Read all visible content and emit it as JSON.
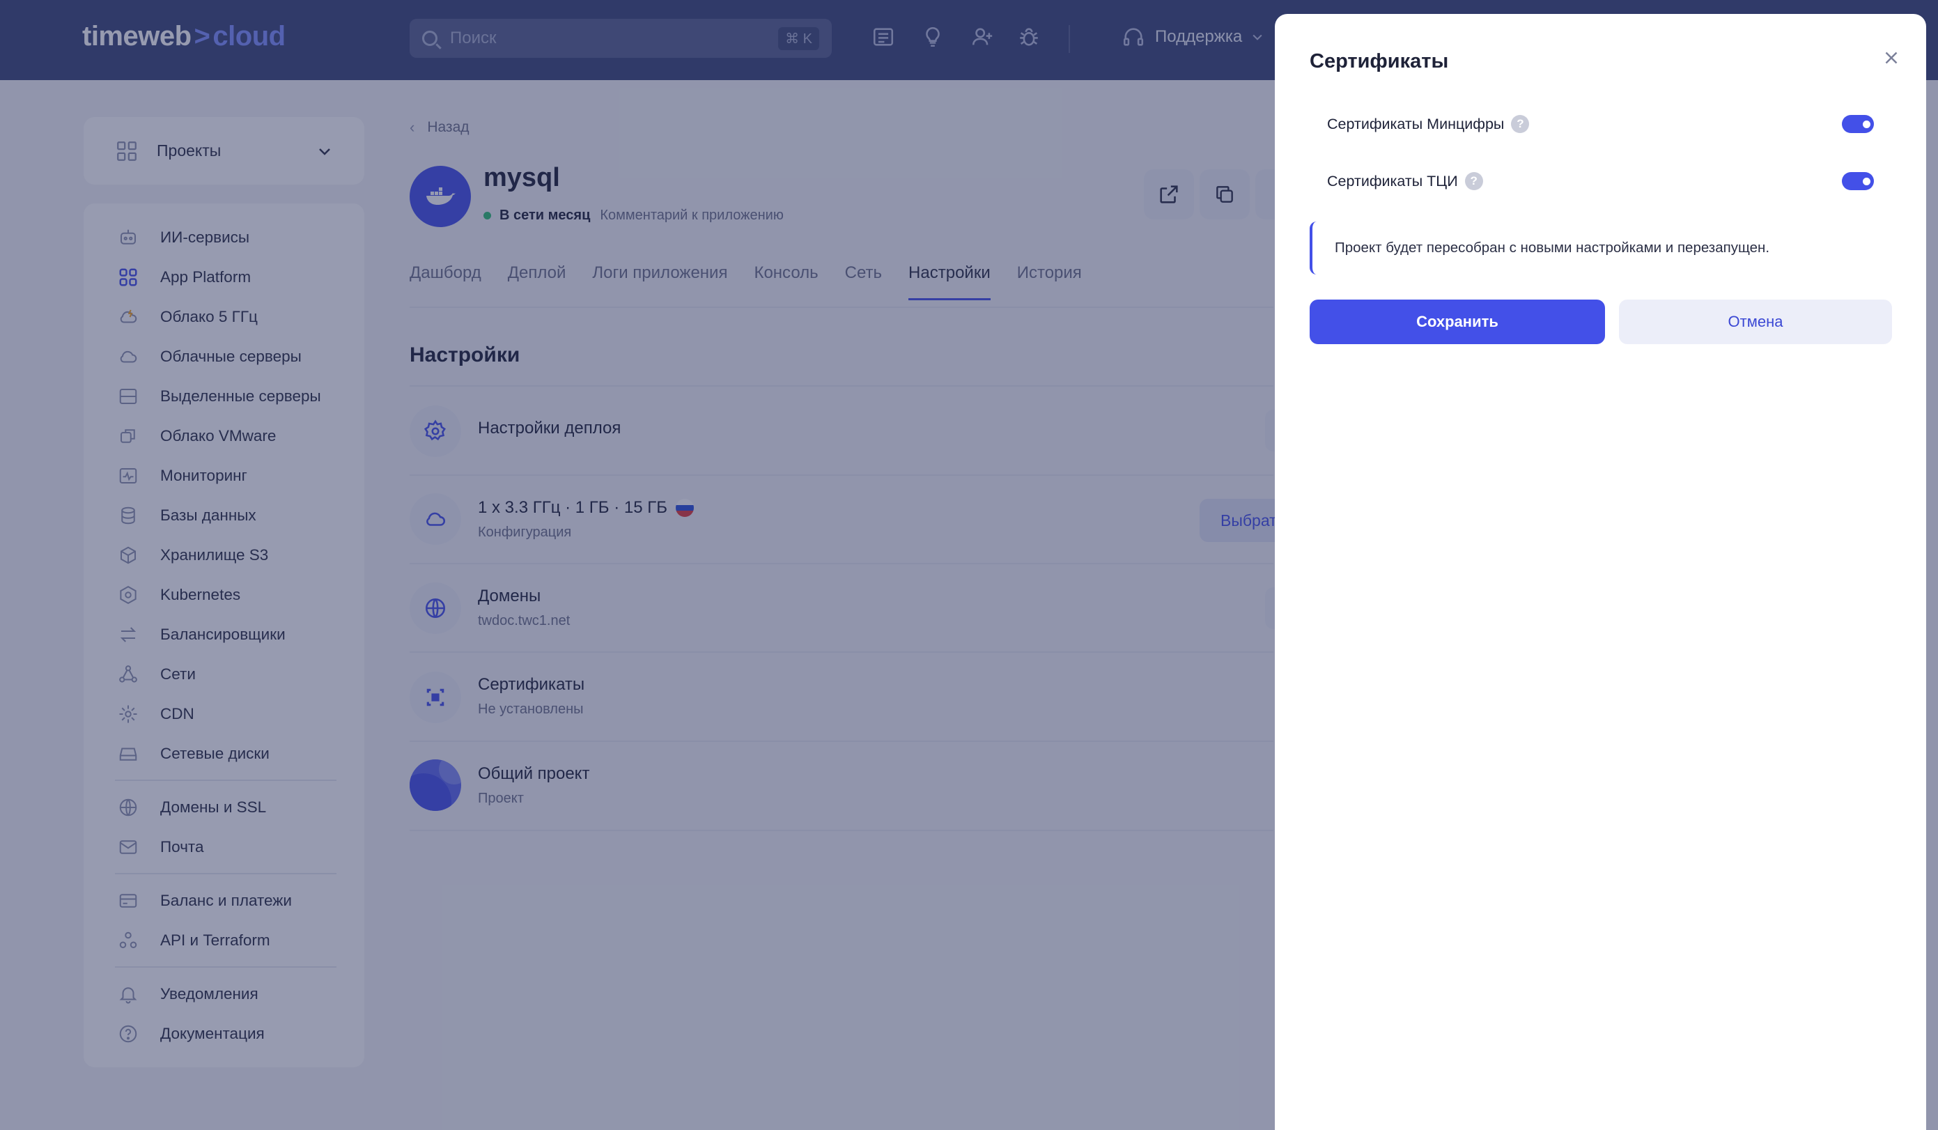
{
  "header": {
    "logo_main": "timeweb",
    "logo_arrow": ">",
    "logo_accent": "cloud",
    "search_placeholder": "Поиск",
    "search_shortcut": "⌘ K",
    "support_label": "Поддержка",
    "icons": [
      "news-icon",
      "lightbulb-icon",
      "add-user-icon",
      "bug-icon",
      "headset-icon"
    ]
  },
  "sidebar": {
    "projects_label": "Проекты",
    "items": [
      {
        "label": "ИИ-сервисы",
        "icon": "robot-icon"
      },
      {
        "label": "App Platform",
        "icon": "app-grid-icon"
      },
      {
        "label": "Облако 5 ГГц",
        "icon": "cloud-lightning-icon"
      },
      {
        "label": "Облачные серверы",
        "icon": "cloud-icon"
      },
      {
        "label": "Выделенные серверы",
        "icon": "server-icon"
      },
      {
        "label": "Облако VMware",
        "icon": "vmware-icon"
      },
      {
        "label": "Мониторинг",
        "icon": "monitoring-icon"
      },
      {
        "label": "Базы данных",
        "icon": "database-icon"
      },
      {
        "label": "Хранилище S3",
        "icon": "cube-icon"
      },
      {
        "label": "Kubernetes",
        "icon": "kubernetes-icon"
      },
      {
        "label": "Балансировщики",
        "icon": "balancer-icon"
      },
      {
        "label": "Сети",
        "icon": "network-icon"
      },
      {
        "label": "CDN",
        "icon": "cdn-icon"
      },
      {
        "label": "Сетевые диски",
        "icon": "disk-icon"
      }
    ],
    "items2": [
      {
        "label": "Домены и SSL",
        "icon": "globe-icon"
      },
      {
        "label": "Почта",
        "icon": "mail-icon"
      }
    ],
    "items3": [
      {
        "label": "Баланс и платежи",
        "icon": "card-icon"
      },
      {
        "label": "API и Terraform",
        "icon": "api-icon"
      }
    ],
    "items4": [
      {
        "label": "Уведомления",
        "icon": "bell-icon"
      },
      {
        "label": "Документация",
        "icon": "help-circle-icon"
      }
    ]
  },
  "main": {
    "back_label": "Назад",
    "app_name": "mysql",
    "status": "В сети месяц",
    "comment": "Комментарий к приложению",
    "tabs": [
      "Дашборд",
      "Деплой",
      "Логи приложения",
      "Консоль",
      "Сеть",
      "Настройки",
      "История"
    ],
    "active_tab": "Настройки",
    "section_title": "Настройки",
    "rows": [
      {
        "title": "Настройки деплоя",
        "sub": ""
      },
      {
        "title": "1 x 3.3 ГГц · 1 ГБ · 15 ГБ",
        "sub": "Конфигурация"
      },
      {
        "title": "Домены",
        "sub": "twdoc.twc1.net"
      },
      {
        "title": "Сертификаты",
        "sub": "Не установлены"
      },
      {
        "title": "Общий проект",
        "sub": "Проект"
      }
    ],
    "choose_label": "Выбрат"
  },
  "drawer": {
    "title": "Сертификаты",
    "options": [
      {
        "label": "Сертификаты Минцифры",
        "enabled": true
      },
      {
        "label": "Сертификаты ТЦИ",
        "enabled": true
      }
    ],
    "help_mark": "?",
    "notice": "Проект будет пересобран с новыми настройками и перезапущен.",
    "save_label": "Сохранить",
    "cancel_label": "Отмена"
  },
  "colors": {
    "accent": "#4350e8",
    "header_bg": "#3a4678",
    "status_online": "#2fbf71"
  }
}
